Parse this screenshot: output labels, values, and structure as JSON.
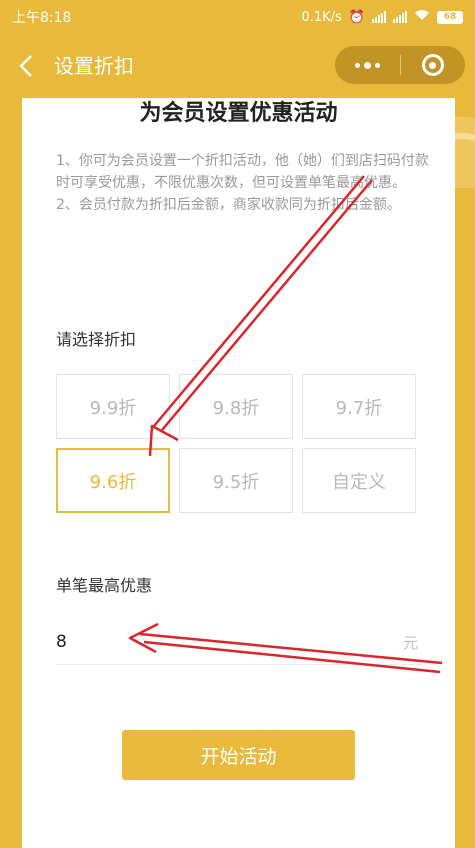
{
  "status_bar": {
    "time": "上午8:18",
    "network_speed": "0.1K/s",
    "battery": "68"
  },
  "nav": {
    "title": "设置折扣"
  },
  "page": {
    "title": "为会员设置优惠活动",
    "desc_line1": "1、你可为会员设置一个折扣活动，他（她）们到店扫码付款时可享受优惠，不限优惠次数，但可设置单笔最高优惠。",
    "desc_line2": "2、会员付款为折扣后金额，商家收款同为折扣后金额。"
  },
  "discount": {
    "label": "请选择折扣",
    "options": [
      "9.9折",
      "9.8折",
      "9.7折",
      "9.6折",
      "9.5折",
      "自定义"
    ],
    "selected": "9.6折"
  },
  "max_discount": {
    "label": "单笔最高优惠",
    "value": "8",
    "unit": "元"
  },
  "actions": {
    "start_label": "开始活动"
  },
  "colors": {
    "accent": "#e8b93a",
    "annotation_arrow": "#d9262b"
  }
}
